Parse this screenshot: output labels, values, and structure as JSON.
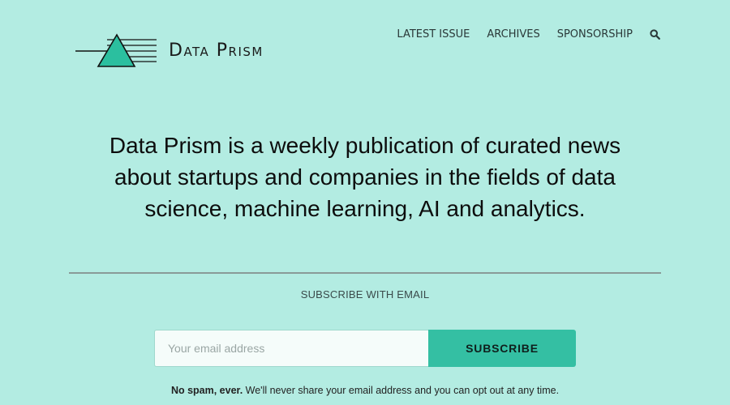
{
  "header": {
    "logo_text": "Data Prism",
    "nav": [
      {
        "label": "LATEST ISSUE"
      },
      {
        "label": "ARCHIVES"
      },
      {
        "label": "SPONSORSHIP"
      }
    ],
    "search_icon": "search-icon"
  },
  "hero": {
    "tagline": "Data Prism is a weekly publication of curated news about startups and companies in the fields of data science, machine learning, AI and analytics."
  },
  "subscribe": {
    "heading": "SUBSCRIBE WITH EMAIL",
    "email_placeholder": "Your email address",
    "email_value": "",
    "button_label": "SUBSCRIBE",
    "fineprint_bold": "No spam, ever.",
    "fineprint_rest": " We'll never share your email address and you can opt out at any time."
  },
  "colors": {
    "background": "#b3ece2",
    "accent": "#34bfa3",
    "logo_triangle": "#2bbf9f"
  }
}
